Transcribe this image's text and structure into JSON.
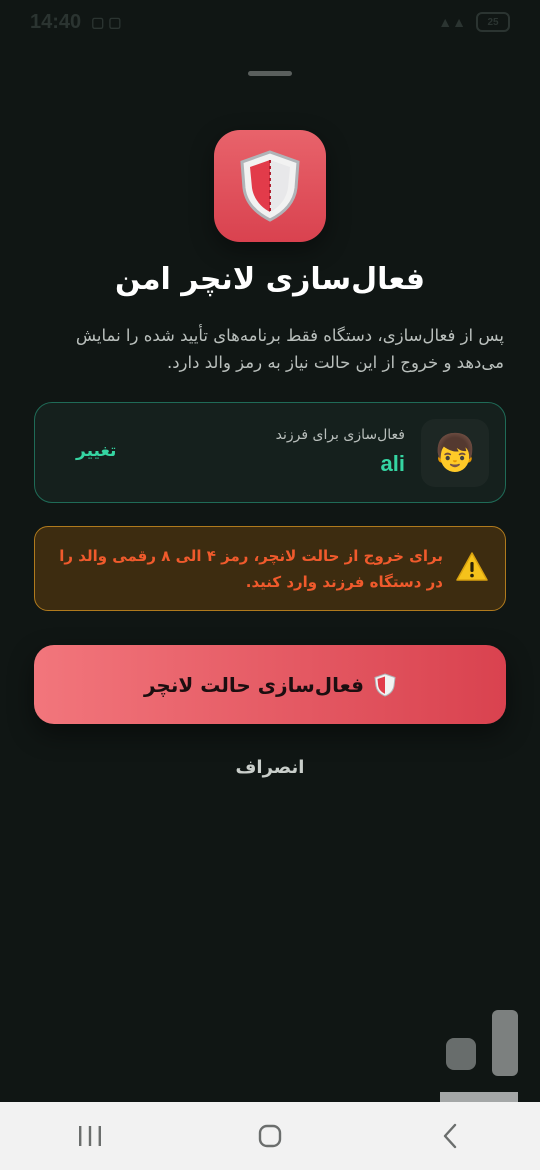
{
  "status_bar": {
    "time": "14:40",
    "battery": "25"
  },
  "dialog": {
    "title": "فعال‌سازی لانچر امن",
    "description": "پس از فعال‌سازی، دستگاه فقط برنامه‌های تأیید شده را نمایش می‌دهد و خروج از این حالت نیاز به رمز والد دارد.",
    "child_card": {
      "label": "فعال‌سازی برای فرزند",
      "name": "ali",
      "avatar_emoji": "👦",
      "change_label": "تغییر",
      "border_color": "#1f6b57"
    },
    "warning": {
      "text": "برای خروج از حالت لانچر، رمز ۴ الی ۸ رقمی والد را در دستگاه فرزند وارد کنید.",
      "icon": "warning-icon",
      "color": "#f05a2c"
    },
    "primary_button": {
      "label": "فعال‌سازی حالت لانچر",
      "icon": "shield-icon",
      "gradient": [
        "#f2767c",
        "#d9424f"
      ]
    },
    "cancel_button": {
      "label": "انصراف"
    }
  },
  "nav_bar": {
    "recents_icon": "recents-icon",
    "home_icon": "home-icon",
    "back_icon": "back-icon"
  },
  "colors": {
    "background": "#101614",
    "accent_green": "#35d5a2",
    "accent_red": "#d9424f"
  }
}
